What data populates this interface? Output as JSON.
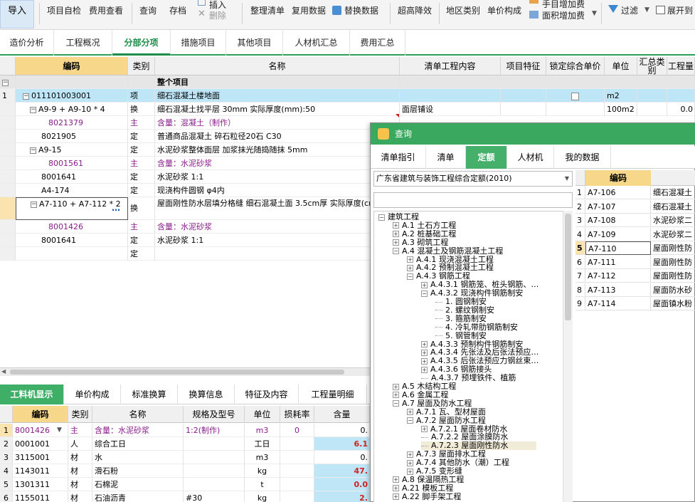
{
  "toolbar": {
    "import": "导入",
    "self_check": "项目自检",
    "fee_view": "费用查看",
    "query": "查询",
    "save": "存档",
    "insert": "插入",
    "delete": "删除",
    "organize": "整理清单",
    "reuse": "复用数据",
    "replace": "替换数据",
    "super_fall": "超高降效",
    "region": "地区类别",
    "unit_price": "单价构成",
    "manual_fee": "手目增加费",
    "area_fee": "面积增加费",
    "filter": "过滤",
    "expand": "展开到"
  },
  "main_tabs": [
    "造价分析",
    "工程概况",
    "分部分项",
    "措施项目",
    "其他项目",
    "人材机汇总",
    "费用汇总"
  ],
  "grid": {
    "headers": [
      "编码",
      "类别",
      "名称",
      "清单工程内容",
      "项目特征",
      "锁定综合单价",
      "单位",
      "汇总类别",
      "工程量"
    ],
    "rows": [
      {
        "no": "",
        "code": "",
        "type": "",
        "name": "整个项目",
        "content": "",
        "unit": "",
        "qty": ""
      },
      {
        "no": "1",
        "code": "011101003001",
        "type": "项",
        "name": "细石混凝土楼地面",
        "content": "",
        "unit": "m2",
        "qty": ""
      },
      {
        "no": "",
        "code": "A9-9 + A9-10 * 4",
        "type": "换",
        "name": "细石混凝土找平层 30mm  实际厚度(mm):50",
        "content": "面层铺设",
        "unit": "100m2",
        "qty": "0.0"
      },
      {
        "no": "",
        "code": "8021379",
        "type": "主",
        "name": "含量：混凝土（制作）",
        "content": "",
        "unit": "",
        "qty": ""
      },
      {
        "no": "",
        "code": "8021905",
        "type": "定",
        "name": "普通商品混凝土  碎石粒径20石 C30",
        "content": "",
        "unit": "",
        "qty": ""
      },
      {
        "no": "",
        "code": "A9-15",
        "type": "定",
        "name": "水泥砂浆整体面层 加浆抹光随捣随抹 5mm",
        "content": "",
        "unit": "",
        "qty": ""
      },
      {
        "no": "",
        "code": "8001561",
        "type": "主",
        "name": "含量：水泥砂浆",
        "content": "",
        "unit": "",
        "qty": ""
      },
      {
        "no": "",
        "code": "8001641",
        "type": "定",
        "name": "水泥砂浆 1:1",
        "content": "",
        "unit": "",
        "qty": ""
      },
      {
        "no": "",
        "code": "A4-174",
        "type": "定",
        "name": "现浇构件圆钢 φ4内",
        "content": "",
        "unit": "",
        "qty": ""
      },
      {
        "no": "",
        "code": "A7-110 + A7-112 * 2",
        "type": "换",
        "name": "屋面刚性防水层填分格缝 细石混凝土面 3.5cm厚  实际厚度(cm):5",
        "content": "",
        "unit": "",
        "qty": ""
      },
      {
        "no": "",
        "code": "8001426",
        "type": "主",
        "name": "含量：水泥砂浆",
        "content": "",
        "unit": "",
        "qty": ""
      },
      {
        "no": "",
        "code": "8001641",
        "type": "定",
        "name": "水泥砂浆 1:1",
        "content": "",
        "unit": "",
        "qty": ""
      },
      {
        "no": "",
        "code": "",
        "type": "定",
        "name": "",
        "content": "",
        "unit": "",
        "qty": ""
      }
    ]
  },
  "lower": {
    "tabs": [
      "工料机显示",
      "单价构成",
      "标准换算",
      "换算信息",
      "特征及内容",
      "工程量明细"
    ],
    "headers": [
      "编码",
      "类别",
      "名称",
      "规格及型号",
      "单位",
      "损耗率",
      "含量"
    ],
    "rows": [
      {
        "no": "1",
        "code": "8001426",
        "type": "主",
        "name": "含量：水泥砂浆",
        "spec": "1:2(制作)",
        "unit": "m3",
        "loss": "0",
        "amount": "0."
      },
      {
        "no": "2",
        "code": "0001001",
        "type": "人",
        "name": "综合工日",
        "spec": "",
        "unit": "工日",
        "loss": "",
        "amount": "6.1"
      },
      {
        "no": "3",
        "code": "3115001",
        "type": "材",
        "name": "水",
        "spec": "",
        "unit": "m3",
        "loss": "",
        "amount": "0."
      },
      {
        "no": "4",
        "code": "1143011",
        "type": "材",
        "name": "滑石粉",
        "spec": "",
        "unit": "kg",
        "loss": "",
        "amount": "47."
      },
      {
        "no": "5",
        "code": "1301311",
        "type": "材",
        "name": "石棉泥",
        "spec": "",
        "unit": "t",
        "loss": "",
        "amount": "0.0"
      },
      {
        "no": "6",
        "code": "1155011",
        "type": "材",
        "name": "石油沥青",
        "spec": "#30",
        "unit": "kg",
        "loss": "",
        "amount": "2."
      }
    ]
  },
  "dialog": {
    "title": "查询",
    "tabs": [
      "清单指引",
      "清单",
      "定额",
      "人材机",
      "我的数据"
    ],
    "dropdown": "广东省建筑与装饰工程综合定额(2010)",
    "tree": [
      {
        "label": "建筑工程",
        "indent": 0,
        "sign": "−"
      },
      {
        "label": "A.1 土石方工程",
        "indent": 1,
        "sign": "+"
      },
      {
        "label": "A.2 桩基础工程",
        "indent": 1,
        "sign": "+"
      },
      {
        "label": "A.3 砌筑工程",
        "indent": 1,
        "sign": "+"
      },
      {
        "label": "A.4 混凝土及钢筋混凝土工程",
        "indent": 1,
        "sign": "−"
      },
      {
        "label": "A.4.1 现浇混凝土工程",
        "indent": 2,
        "sign": "+"
      },
      {
        "label": "A.4.2 预制混凝土工程",
        "indent": 2,
        "sign": "+"
      },
      {
        "label": "A.4.3 钢筋工程",
        "indent": 2,
        "sign": "−"
      },
      {
        "label": "A.4.3.1 钢筋笼、桩头钢筋、…",
        "indent": 3,
        "sign": "+"
      },
      {
        "label": "A.4.3.2 现浇构件钢筋制安",
        "indent": 3,
        "sign": "−"
      },
      {
        "label": "1. 圆钢制安",
        "indent": 4,
        "sign": ""
      },
      {
        "label": "2. 螺纹钢制安",
        "indent": 4,
        "sign": ""
      },
      {
        "label": "3. 箍筋制安",
        "indent": 4,
        "sign": ""
      },
      {
        "label": "4. 冷轧带肋钢筋制安",
        "indent": 4,
        "sign": ""
      },
      {
        "label": "5. 钢管制安",
        "indent": 4,
        "sign": ""
      },
      {
        "label": "A.4.3.3 预制构件钢筋制安",
        "indent": 3,
        "sign": "+"
      },
      {
        "label": "A.4.3.4 先张法及后张法预应…",
        "indent": 3,
        "sign": "+"
      },
      {
        "label": "A.4.3.5 后张法预应力钢丝束…",
        "indent": 3,
        "sign": "+"
      },
      {
        "label": "A.4.3.6 钢筋接头",
        "indent": 3,
        "sign": "+"
      },
      {
        "label": "A.4.3.7 预埋铁件、植筋",
        "indent": 3,
        "sign": ""
      },
      {
        "label": "A.5 木结构工程",
        "indent": 1,
        "sign": "+"
      },
      {
        "label": "A.6 金属工程",
        "indent": 1,
        "sign": "+"
      },
      {
        "label": "A.7 屋面及防水工程",
        "indent": 1,
        "sign": "−"
      },
      {
        "label": "A.7.1 瓦、型材屋面",
        "indent": 2,
        "sign": "+"
      },
      {
        "label": "A.7.2 屋面防水工程",
        "indent": 2,
        "sign": "−"
      },
      {
        "label": "A.7.2.1 屋面卷材防水",
        "indent": 3,
        "sign": "+"
      },
      {
        "label": "A.7.2.2 屋面涂膜防水",
        "indent": 3,
        "sign": ""
      },
      {
        "label": "A.7.2.3 屋面刚性防水",
        "indent": 3,
        "sign": "",
        "selected": true
      },
      {
        "label": "A.7.3 屋面排水工程",
        "indent": 2,
        "sign": "+"
      },
      {
        "label": "A.7.4 其他防水（潮）工程",
        "indent": 2,
        "sign": "+"
      },
      {
        "label": "A.7.5 变形缝",
        "indent": 2,
        "sign": "+"
      },
      {
        "label": "A.8 保温隔热工程",
        "indent": 1,
        "sign": "+"
      },
      {
        "label": "A.21 模板工程",
        "indent": 1,
        "sign": "+"
      },
      {
        "label": "A.22 脚手架工程",
        "indent": 1,
        "sign": "+"
      }
    ],
    "result_header": "编码",
    "results": [
      {
        "no": "1",
        "code": "A7-106",
        "name": "细石混凝土"
      },
      {
        "no": "2",
        "code": "A7-107",
        "name": "细石混凝土"
      },
      {
        "no": "3",
        "code": "A7-108",
        "name": "水泥砂浆二"
      },
      {
        "no": "4",
        "code": "A7-109",
        "name": "水泥砂浆二"
      },
      {
        "no": "5",
        "code": "A7-110",
        "name": "屋面刚性防"
      },
      {
        "no": "6",
        "code": "A7-111",
        "name": "屋面刚性防"
      },
      {
        "no": "7",
        "code": "A7-112",
        "name": "屋面刚性防"
      },
      {
        "no": "8",
        "code": "A7-113",
        "name": "屋面防水砂"
      },
      {
        "no": "9",
        "code": "A7-114",
        "name": "屋面镇水粉"
      }
    ]
  },
  "colors": {
    "accent": "#3aa85e",
    "selected_row": "#bfe6f7",
    "purple": "#8a1c8a"
  }
}
